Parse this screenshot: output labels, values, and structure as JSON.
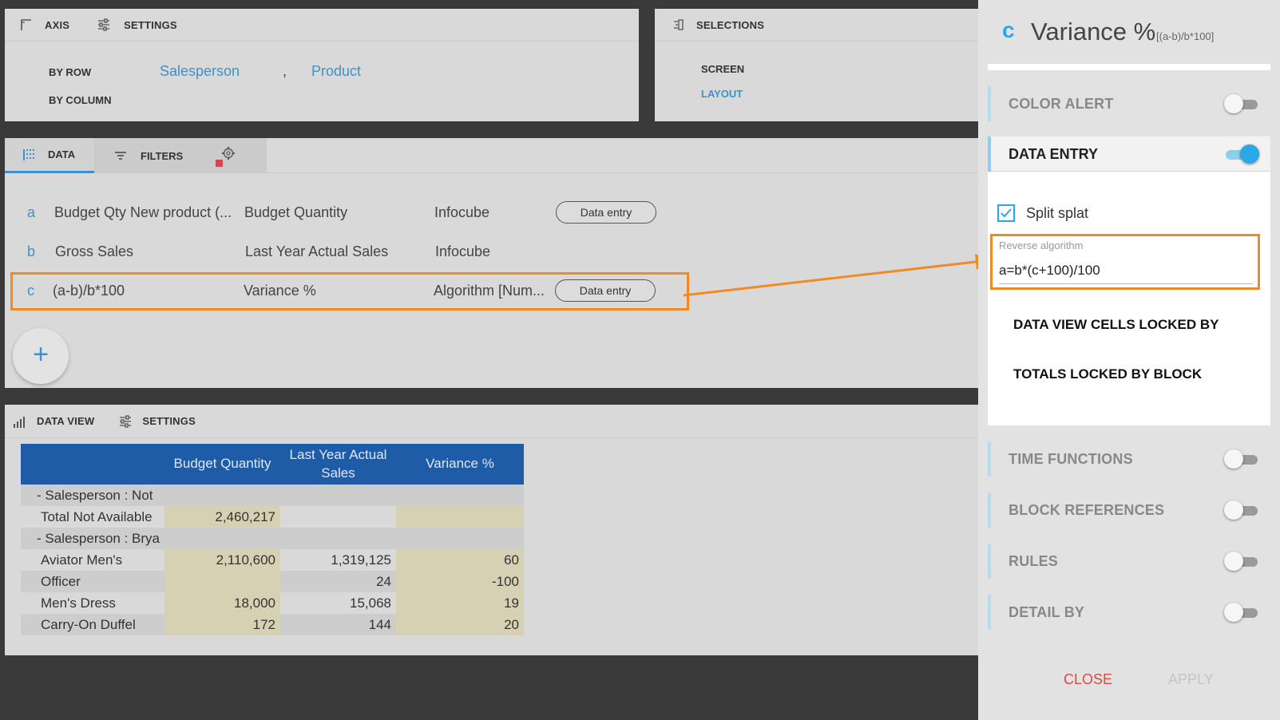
{
  "axis": {
    "tab_axis": "AXIS",
    "tab_settings": "SETTINGS",
    "by_row_label": "BY ROW",
    "by_column_label": "BY COLUMN",
    "row_fields": [
      "Salesperson",
      "Product"
    ],
    "separator": ","
  },
  "selections": {
    "title": "SELECTIONS",
    "items": [
      "SCREEN",
      "LAYOUT"
    ]
  },
  "data_tabs": {
    "data": "DATA",
    "filters": "FILTERS"
  },
  "data_rows": [
    {
      "letter": "a",
      "formula": "Budget Qty New product (...",
      "name": "Budget Quantity",
      "source": "Infocube",
      "button": "Data entry"
    },
    {
      "letter": "b",
      "formula": "Gross Sales",
      "name": "Last Year Actual Sales",
      "source": "Infocube",
      "button": ""
    },
    {
      "letter": "c",
      "formula": "(a-b)/b*100",
      "name": "Variance %",
      "source": "Algorithm [Num...",
      "button": "Data entry"
    }
  ],
  "add_button": "+",
  "dataview": {
    "tab_dataview": "DATA VIEW",
    "tab_settings": "SETTINGS",
    "columns": [
      "Budget Quantity",
      "Last Year Actual Sales",
      "Variance %"
    ],
    "rows": [
      {
        "label": "-  Salesperson : Not",
        "cells": [
          "",
          "",
          ""
        ],
        "group": true
      },
      {
        "label": "Total Not Available",
        "cells": [
          "2,460,217",
          "",
          ""
        ]
      },
      {
        "label": "-  Salesperson : Brya",
        "cells": [
          "",
          "",
          ""
        ],
        "group": true
      },
      {
        "label": "Aviator Men's",
        "cells": [
          "2,110,600",
          "1,319,125",
          "60"
        ]
      },
      {
        "label": "Officer",
        "cells": [
          "",
          "24",
          "-100"
        ]
      },
      {
        "label": "Men's Dress",
        "cells": [
          "18,000",
          "15,068",
          "19"
        ]
      },
      {
        "label": "Carry-On Duffel",
        "cells": [
          "172",
          "144",
          "20"
        ]
      }
    ]
  },
  "sidebar": {
    "letter": "c",
    "title": "Variance %",
    "formula": "[(a-b)/b*100]",
    "sections_top": [
      {
        "label": "COLOR ALERT",
        "on": false
      },
      {
        "label": "DATA ENTRY",
        "on": true
      }
    ],
    "split_label": "Split splat",
    "reverse_label": "Reverse algorithm",
    "reverse_value": "a=b*(c+100)/100",
    "locked_cells": "DATA VIEW CELLS LOCKED BY",
    "locked_totals": "TOTALS LOCKED BY BLOCK",
    "sections_bottom": [
      {
        "label": "TIME FUNCTIONS",
        "on": false
      },
      {
        "label": "BLOCK REFERENCES",
        "on": false
      },
      {
        "label": "RULES",
        "on": false
      },
      {
        "label": "DETAIL BY",
        "on": false
      }
    ],
    "close": "CLOSE",
    "apply": "APPLY"
  },
  "colors": {
    "accent": "#3e92c8",
    "highlight": "#f08a24",
    "table_header": "#1f5ca8",
    "toggle_on": "#2aa7e6",
    "close": "#e2483d"
  }
}
